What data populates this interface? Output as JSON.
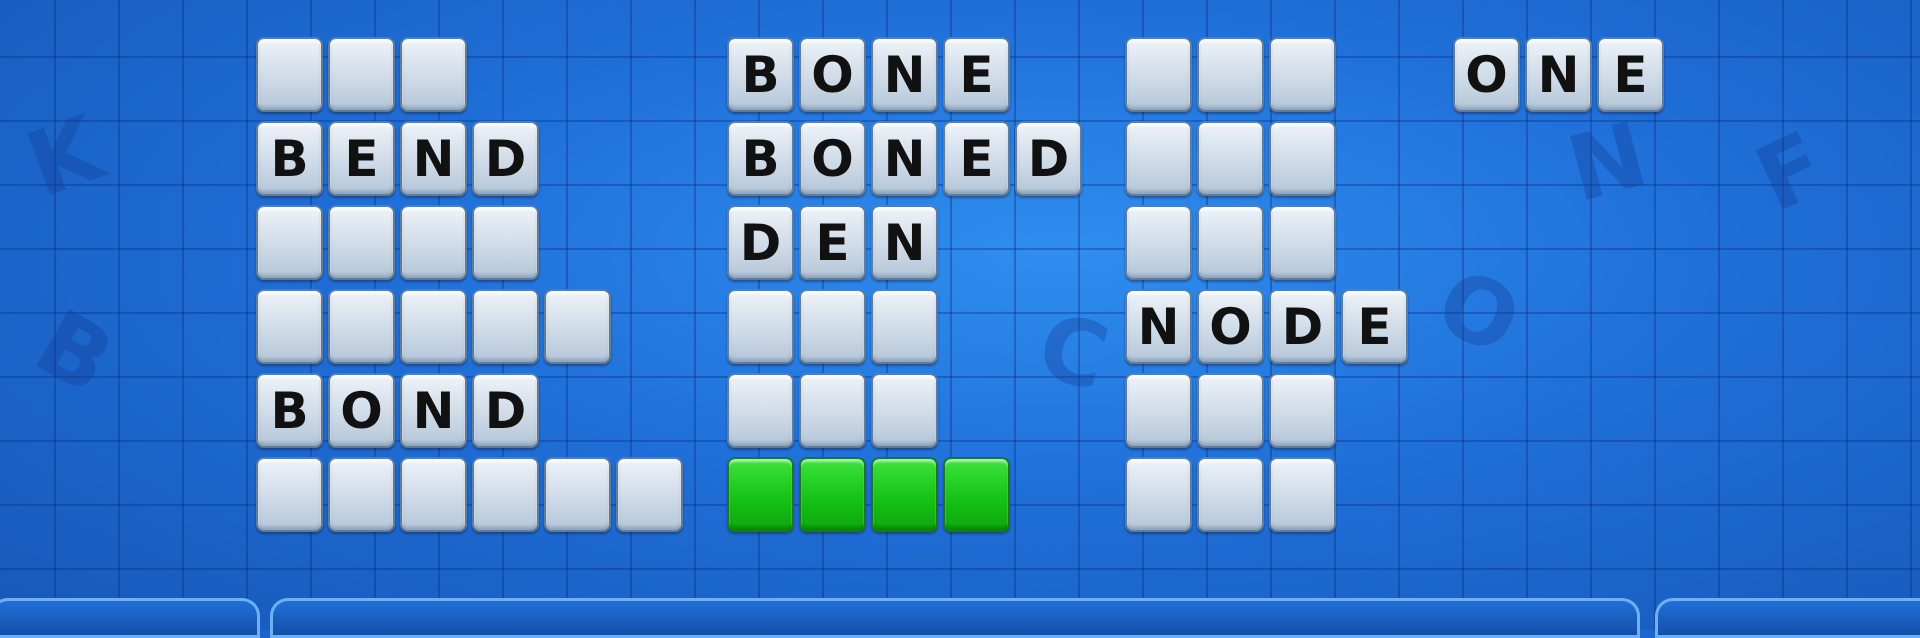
{
  "board": {
    "columns": [
      {
        "rows": [
          {
            "letters": [
              "",
              "",
              ""
            ]
          },
          {
            "letters": [
              "B",
              "E",
              "N",
              "D"
            ]
          },
          {
            "letters": [
              "",
              "",
              "",
              ""
            ]
          },
          {
            "letters": [
              "",
              "",
              "",
              "",
              ""
            ]
          },
          {
            "letters": [
              "B",
              "O",
              "N",
              "D"
            ]
          },
          {
            "letters": [
              "",
              "",
              "",
              "",
              "",
              ""
            ]
          }
        ]
      },
      {
        "rows": [
          {
            "letters": [
              "B",
              "O",
              "N",
              "E"
            ]
          },
          {
            "letters": [
              "B",
              "O",
              "N",
              "E",
              "D"
            ]
          },
          {
            "letters": [
              "D",
              "E",
              "N"
            ]
          },
          {
            "letters": [
              "",
              "",
              ""
            ]
          },
          {
            "letters": [
              "",
              "",
              ""
            ]
          },
          {
            "letters": [
              "",
              "",
              "",
              ""
            ],
            "highlight": "green"
          }
        ]
      },
      {
        "rows": [
          {
            "letters": [
              "",
              "",
              ""
            ]
          },
          {
            "letters": [
              "",
              "",
              ""
            ]
          },
          {
            "letters": [
              "",
              "",
              ""
            ]
          },
          {
            "letters": [
              "N",
              "O",
              "D",
              "E"
            ]
          },
          {
            "letters": [
              "",
              "",
              ""
            ]
          },
          {
            "letters": [
              "",
              "",
              ""
            ]
          }
        ]
      },
      {
        "rows": [
          {
            "letters": [
              "O",
              "N",
              "E"
            ]
          }
        ]
      }
    ]
  },
  "colors": {
    "background": "#1f6fd8",
    "tile": "#cfdbe8",
    "highlight_tile": "#16c416",
    "letter": "#111111"
  }
}
